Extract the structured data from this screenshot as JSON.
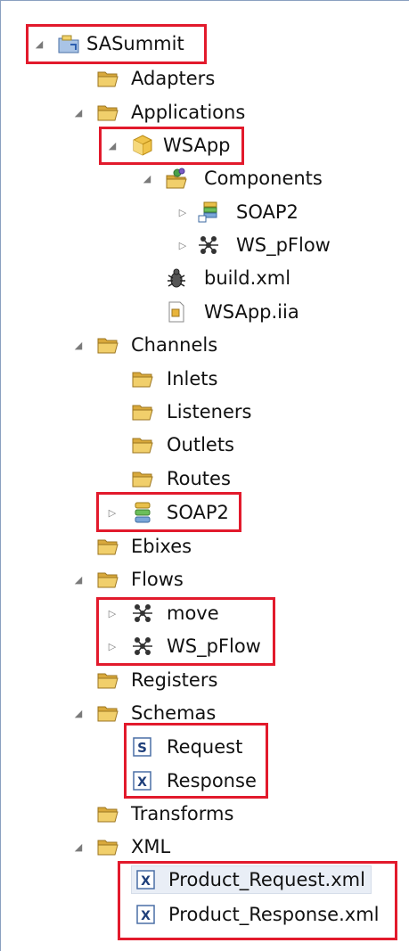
{
  "tree": [
    {
      "id": "sasummit",
      "label": "SASummit",
      "icon": "project-icon",
      "expanded": true
    },
    {
      "id": "adapters",
      "label": "Adapters",
      "icon": "folder-icon"
    },
    {
      "id": "applications",
      "label": "Applications",
      "icon": "folder-icon",
      "expanded": true
    },
    {
      "id": "wsapp",
      "label": "WSApp",
      "icon": "package-icon",
      "expanded": true
    },
    {
      "id": "components",
      "label": "Components",
      "icon": "components-folder-icon",
      "expanded": true
    },
    {
      "id": "soap2-component",
      "label": "SOAP2",
      "icon": "soap-component-icon",
      "expanded": false
    },
    {
      "id": "ws-pflow-component",
      "label": "WS_pFlow",
      "icon": "flow-icon",
      "expanded": false
    },
    {
      "id": "build-xml",
      "label": "build.xml",
      "icon": "ant-bug-icon"
    },
    {
      "id": "wsapp-iia",
      "label": "WSApp.iia",
      "icon": "iia-file-icon"
    },
    {
      "id": "channels",
      "label": "Channels",
      "icon": "folder-icon",
      "expanded": true
    },
    {
      "id": "inlets",
      "label": "Inlets",
      "icon": "folder-icon"
    },
    {
      "id": "listeners",
      "label": "Listeners",
      "icon": "folder-icon"
    },
    {
      "id": "outlets",
      "label": "Outlets",
      "icon": "folder-icon"
    },
    {
      "id": "routes",
      "label": "Routes",
      "icon": "folder-icon"
    },
    {
      "id": "soap2-channel",
      "label": "SOAP2",
      "icon": "channel-stack-icon",
      "expanded": false
    },
    {
      "id": "ebixes",
      "label": "Ebixes",
      "icon": "folder-icon"
    },
    {
      "id": "flows",
      "label": "Flows",
      "icon": "folder-icon",
      "expanded": true
    },
    {
      "id": "move",
      "label": "move",
      "icon": "flow-icon",
      "expanded": false
    },
    {
      "id": "ws-pflow",
      "label": "WS_pFlow",
      "icon": "flow-icon",
      "expanded": false
    },
    {
      "id": "registers",
      "label": "Registers",
      "icon": "folder-icon"
    },
    {
      "id": "schemas",
      "label": "Schemas",
      "icon": "folder-icon",
      "expanded": true
    },
    {
      "id": "request",
      "label": "Request",
      "icon": "schema-s-icon"
    },
    {
      "id": "response",
      "label": "Response",
      "icon": "xml-x-icon"
    },
    {
      "id": "transforms",
      "label": "Transforms",
      "icon": "folder-icon"
    },
    {
      "id": "xml",
      "label": "XML",
      "icon": "folder-icon",
      "expanded": true
    },
    {
      "id": "product-request-xml",
      "label": "Product_Request.xml",
      "icon": "xml-x-icon",
      "selected": true
    },
    {
      "id": "product-response-xml",
      "label": "Product_Response.xml",
      "icon": "xml-x-icon"
    }
  ],
  "colors": {
    "highlight": "#e21a2c",
    "folder": "#e8c15a",
    "selection": "#e9eef6"
  }
}
